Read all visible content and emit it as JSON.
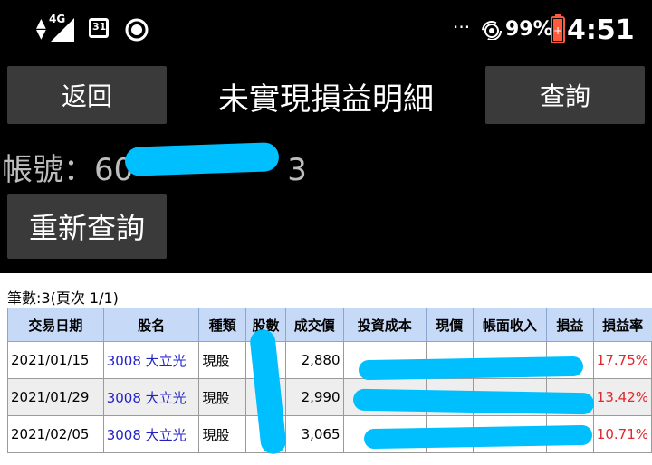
{
  "status_bar": {
    "network": "4G",
    "calendar_day": "31",
    "battery": "99%",
    "time": "4:51",
    "more": "···"
  },
  "header": {
    "back_label": "返回",
    "title": "未實現損益明細",
    "query_label": "查詢",
    "account_label": "帳號：",
    "account_prefix": "60",
    "account_suffix": "3",
    "requery_label": "重新查詢"
  },
  "summary": {
    "count_text": "筆數:3(頁次 1/1)"
  },
  "table": {
    "columns": [
      "交易日期",
      "股名",
      "種類",
      "股數",
      "成交價",
      "投資成本",
      "現價",
      "帳面收入",
      "損益",
      "損益率"
    ],
    "rows": [
      {
        "date": "2021/01/15",
        "name": "3008 大立光",
        "type": "現股",
        "price": "2,880",
        "pl_rate": "17.75%"
      },
      {
        "date": "2021/01/29",
        "name": "3008 大立光",
        "type": "現股",
        "price": "2,990",
        "pl_rate": "13.42%"
      },
      {
        "date": "2021/02/05",
        "name": "3008 大立光",
        "type": "現股",
        "price": "3,065",
        "pl_rate": "10.71%"
      }
    ]
  },
  "colors": {
    "header_bg": "#c6daf8",
    "link": "#2222c8",
    "loss_gain": "#e0282f",
    "redaction": "#00bfff"
  }
}
